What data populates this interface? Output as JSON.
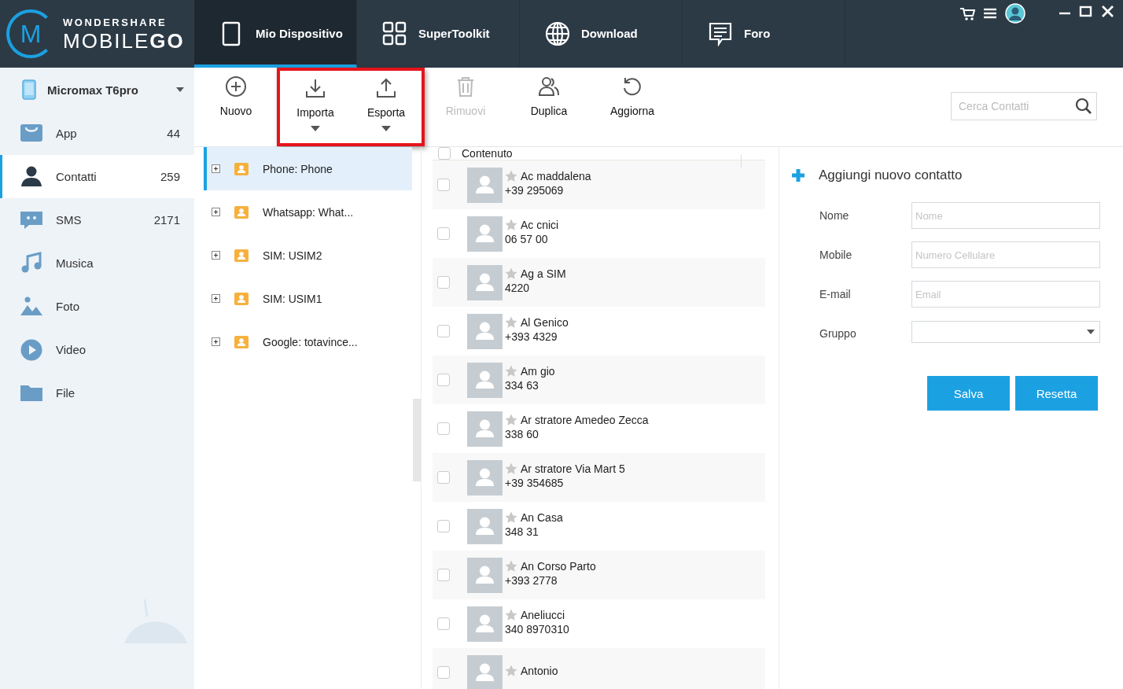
{
  "logo": {
    "letter": "M",
    "maker": "WONDERSHARE",
    "name": "MOBILE",
    "name_bold": "GO"
  },
  "nav_tabs": [
    {
      "kind": "device",
      "label": "Mio Dispositivo",
      "selected": true
    },
    {
      "kind": "toolkit",
      "label": "SuperToolkit",
      "selected": false
    },
    {
      "kind": "download",
      "label": "Download",
      "selected": false
    },
    {
      "kind": "forum",
      "label": "Foro",
      "selected": false
    }
  ],
  "device": {
    "name": "Micromax T6pro"
  },
  "sidebar": {
    "items": [
      {
        "kind": "app",
        "label": "App",
        "count": "44",
        "selected": false
      },
      {
        "kind": "contacts",
        "label": "Contatti",
        "count": "259",
        "selected": true
      },
      {
        "kind": "sms",
        "label": "SMS",
        "count": "2171",
        "selected": false
      },
      {
        "kind": "music",
        "label": "Musica",
        "selected": false
      },
      {
        "kind": "photo",
        "label": "Foto",
        "selected": false
      },
      {
        "kind": "video",
        "label": "Video",
        "selected": false
      },
      {
        "kind": "file",
        "label": "File",
        "selected": false
      }
    ]
  },
  "toolbar": {
    "buttons": [
      {
        "kind": "new",
        "label": "Nuovo",
        "disabled": false,
        "dropdown": false,
        "highlighted": false
      },
      {
        "kind": "import",
        "label": "Importa",
        "disabled": false,
        "dropdown": true,
        "highlighted": true
      },
      {
        "kind": "export",
        "label": "Esporta",
        "disabled": false,
        "dropdown": true,
        "highlighted": true
      },
      {
        "kind": "remove",
        "label": "Rimuovi",
        "disabled": true,
        "dropdown": false,
        "highlighted": false
      },
      {
        "kind": "duplicate",
        "label": "Duplica",
        "disabled": false,
        "dropdown": false,
        "highlighted": false
      },
      {
        "kind": "refresh",
        "label": "Aggiorna",
        "disabled": false,
        "dropdown": false,
        "highlighted": false
      }
    ],
    "search": {
      "placeholder": "Cerca Contatti"
    }
  },
  "groups": [
    {
      "label": "Phone: Phone",
      "selected": true
    },
    {
      "label": "Whatsapp: What...",
      "selected": false
    },
    {
      "label": "SIM: USIM2",
      "selected": false
    },
    {
      "label": "SIM: USIM1",
      "selected": false
    },
    {
      "label": "Google: totavince...",
      "selected": false
    }
  ],
  "contacts": {
    "header": "Contenuto",
    "all_checked": false,
    "rows": [
      {
        "name": "Ac maddalena",
        "phone": "+39 295069",
        "checked": false
      },
      {
        "name": "Ac cnici",
        "phone": "06 57 00",
        "checked": false
      },
      {
        "name": "Ag a SIM",
        "phone": "4220",
        "checked": false
      },
      {
        "name": "Al Genico",
        "phone": "+393 4329",
        "checked": false
      },
      {
        "name": "Am gio",
        "phone": "334 63",
        "checked": false
      },
      {
        "name": "Ar stratore Amedeo Zecca",
        "phone": "338 60",
        "checked": false
      },
      {
        "name": "Ar stratore Via Mart 5",
        "phone": "+39 354685",
        "checked": false
      },
      {
        "name": "An Casa",
        "phone": "348 31",
        "checked": false
      },
      {
        "name": "An Corso Parto",
        "phone": "+393 2778",
        "checked": false
      },
      {
        "name": "Aneliucci",
        "phone": "340 8970310",
        "checked": false
      },
      {
        "name": "Antonio",
        "checked": false
      }
    ]
  },
  "form": {
    "title": "Aggiungi nuovo contatto",
    "fields": [
      {
        "kind": "text",
        "label": "Nome",
        "placeholder": "Nome"
      },
      {
        "kind": "text",
        "label": "Mobile",
        "placeholder": "Numero Cellulare"
      },
      {
        "kind": "text",
        "label": "E-mail",
        "placeholder": "Email"
      },
      {
        "kind": "select",
        "label": "Gruppo"
      }
    ],
    "buttons": [
      "Salva",
      "Resetta"
    ]
  }
}
